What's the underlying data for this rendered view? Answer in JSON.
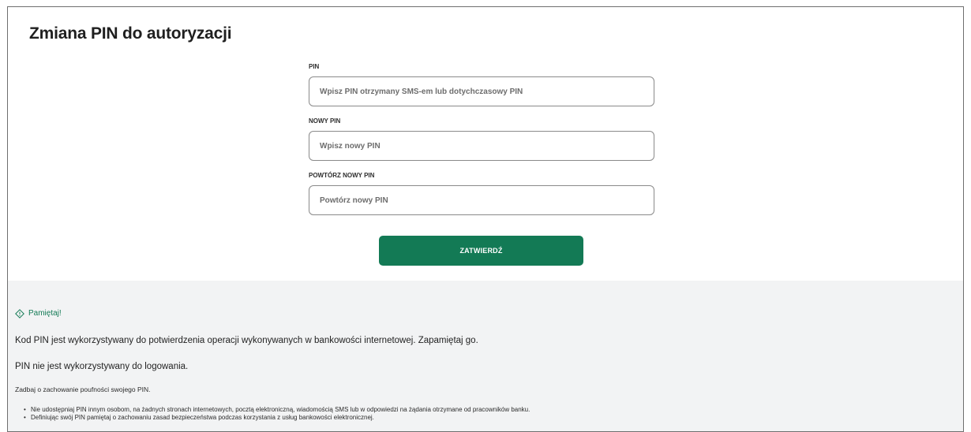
{
  "page": {
    "title": "Zmiana PIN do autoryzacji"
  },
  "form": {
    "pin": {
      "label": "PIN",
      "placeholder": "Wpisz PIN otrzymany SMS-em lub dotychczasowy PIN",
      "value": ""
    },
    "new_pin": {
      "label": "NOWY PIN",
      "placeholder": "Wpisz nowy PIN",
      "value": ""
    },
    "repeat_pin": {
      "label": "POWTÓRZ NOWY PIN",
      "placeholder": "Powtórz nowy PIN",
      "value": ""
    },
    "submit_label": "ZATWIERDŹ"
  },
  "info": {
    "icon": "diamond-info-icon",
    "title": "Pamiętaj!",
    "paragraph1": "Kod PIN jest wykorzystywany do potwierdzenia operacji wykonywanych w bankowości internetowej. Zapamiętaj go.",
    "paragraph2": "PIN nie jest wykorzystywany do logowania.",
    "paragraph3": "Zadbaj o zachowanie poufności swojego PIN.",
    "bullets": [
      "Nie udostępniaj PIN innym osobom, na żadnych stronach internetowych, pocztą elektroniczną, wiadomością SMS lub w odpowiedzi na żądania otrzymane od pracowników banku.",
      "Definiując swój PIN pamiętaj o zachowaniu zasad bezpieczeństwa podczas korzystania z usług bankowości elektronicznej."
    ]
  },
  "colors": {
    "accent": "#137a55",
    "panel_bg": "#f2f3f4",
    "border": "#8a8a8a"
  }
}
